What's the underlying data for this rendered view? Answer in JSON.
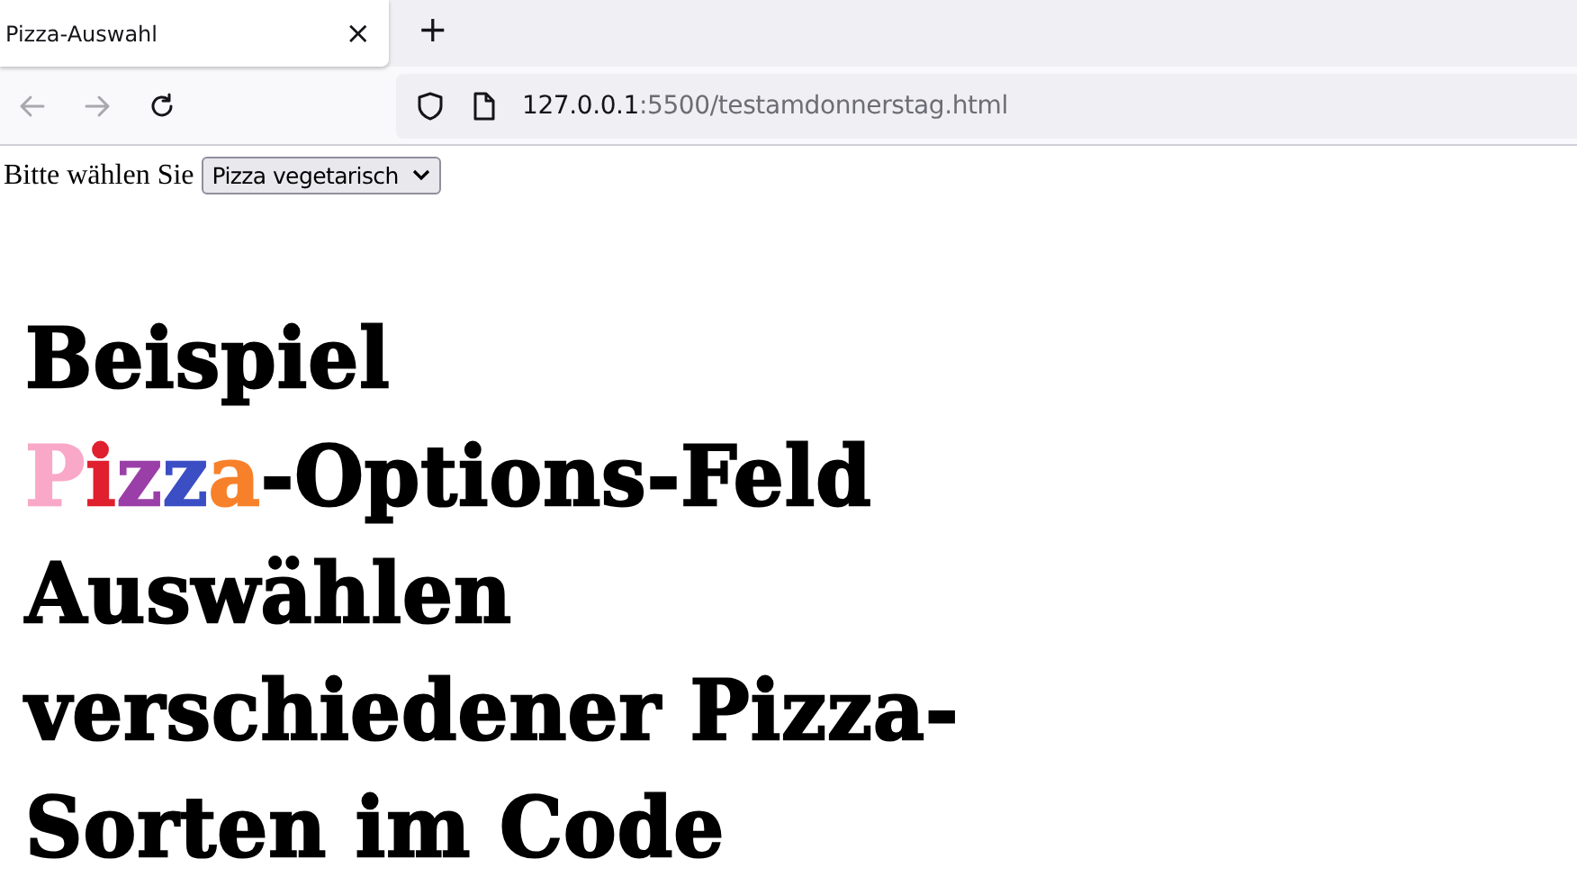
{
  "browser": {
    "tabs": [
      {
        "title": "Pizza-Auswahl",
        "close": "×",
        "selected": true
      }
    ],
    "new_tab": "+",
    "address": {
      "host": "127.0.0.1",
      "rest": ":5500/testamdonnerstag.html"
    }
  },
  "page": {
    "label": "Bitte wählen Sie",
    "select": {
      "value": "Pizza vegetarisch"
    },
    "heading_lines": [
      [
        {
          "text": "Beispiel",
          "color": "#000000"
        }
      ],
      [
        {
          "text": "P",
          "color": "#f9a8c8"
        },
        {
          "text": "i",
          "color": "#e0202e"
        },
        {
          "text": "z",
          "color": "#9b3fa8"
        },
        {
          "text": "z",
          "color": "#3b4ec4"
        },
        {
          "text": "a",
          "color": "#f7812a"
        },
        {
          "text": "-Options-Feld",
          "color": "#000000"
        }
      ],
      [
        {
          "text": "Auswählen",
          "color": "#000000"
        }
      ],
      [
        {
          "text": "verschiedener Pizza-",
          "color": "#000000"
        }
      ],
      [
        {
          "text": "Sorten im Code",
          "color": "#000000"
        }
      ]
    ]
  }
}
